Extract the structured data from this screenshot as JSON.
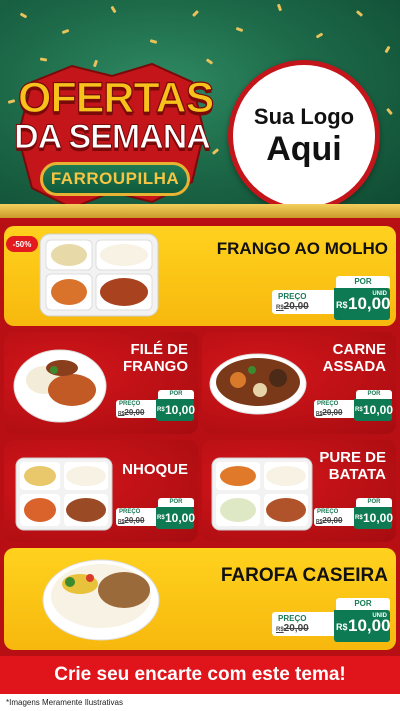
{
  "header": {
    "title_line1": "OFERTAS",
    "title_line2": "DA SEMANA",
    "ribbon": "FARROUPILHA",
    "logo_line1": "Sua Logo",
    "logo_line2": "Aqui"
  },
  "badge": "-50%",
  "products": [
    {
      "name": "FRANGO AO MOLHO",
      "por": "POR",
      "preco_label": "PREÇO",
      "old_prefix": "R$",
      "old_price": "20,00",
      "currency": "R$",
      "price": "10,00",
      "unit": "UNID"
    },
    {
      "name_line1": "FILÉ DE",
      "name_line2": "FRANGO",
      "por": "POR",
      "preco_label": "PREÇO",
      "old_prefix": "R$",
      "old_price": "20,00",
      "currency": "R$",
      "price": "10,00",
      "unit": "UNID"
    },
    {
      "name_line1": "CARNE",
      "name_line2": "ASSADA",
      "por": "POR",
      "preco_label": "PREÇO",
      "old_prefix": "R$",
      "old_price": "20,00",
      "currency": "R$",
      "price": "10,00",
      "unit": "UNID"
    },
    {
      "name": "NHOQUE",
      "por": "POR",
      "preco_label": "PREÇO",
      "old_prefix": "R$",
      "old_price": "20,00",
      "currency": "R$",
      "price": "10,00",
      "unit": "UNID"
    },
    {
      "name_line1": "PURE DE",
      "name_line2": "BATATA",
      "por": "POR",
      "preco_label": "PREÇO",
      "old_prefix": "R$",
      "old_price": "20,00",
      "currency": "R$",
      "price": "10,00",
      "unit": "UNID"
    },
    {
      "name": "FAROFA CASEIRA",
      "por": "POR",
      "preco_label": "PREÇO",
      "old_prefix": "R$",
      "old_price": "20,00",
      "currency": "R$",
      "price": "10,00",
      "unit": "UNID"
    }
  ],
  "cta": "Crie seu encarte com este tema!",
  "footnote": "*Imagens Meramente Ilustrativas",
  "colors": {
    "green": "#0d7a53",
    "red": "#c3151a",
    "yellow": "#ffd21e",
    "gold": "#e8b233"
  }
}
